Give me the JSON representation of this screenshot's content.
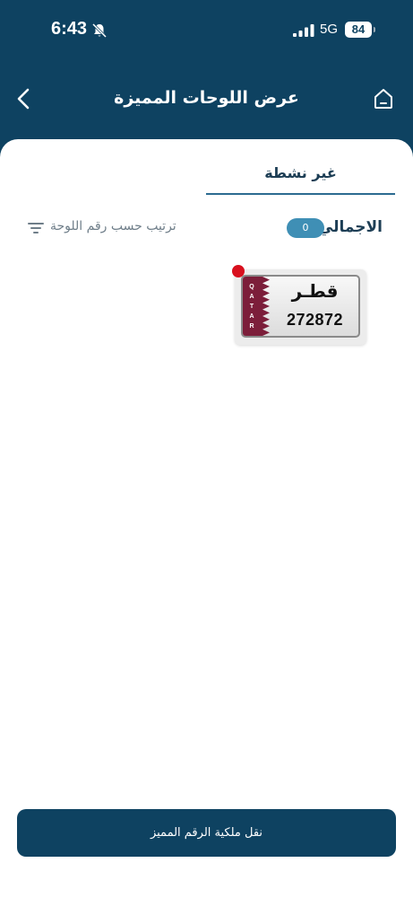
{
  "status_bar": {
    "time": "6:43",
    "network": "5G",
    "battery": "84",
    "icons": [
      "bell-muted-icon",
      "signal-icon"
    ]
  },
  "nav": {
    "title": "عرض اللوحات المميزة",
    "icons": [
      "chevron-left-icon",
      "home-icon"
    ]
  },
  "tabs": [
    {
      "label": "غير نشطة",
      "selected": true
    }
  ],
  "summary": {
    "total_label": "الاجمالي",
    "total_count": "0",
    "sort_label": "ترتيب حسب رقم اللوحة",
    "sort_icon": "filter-lines-icon"
  },
  "plates": [
    {
      "country_arabic": "قطـر",
      "country_letters": [
        "Q",
        "A",
        "T",
        "A",
        "R"
      ],
      "number": "272872",
      "status_dot_color": "#d8101e"
    }
  ],
  "footer": {
    "transfer_label": "نقل ملكية الرقم المميز"
  },
  "colors": {
    "primary": "#0e4261",
    "accent": "#3f8fb5",
    "plate_maroon": "#7c1e3a"
  }
}
